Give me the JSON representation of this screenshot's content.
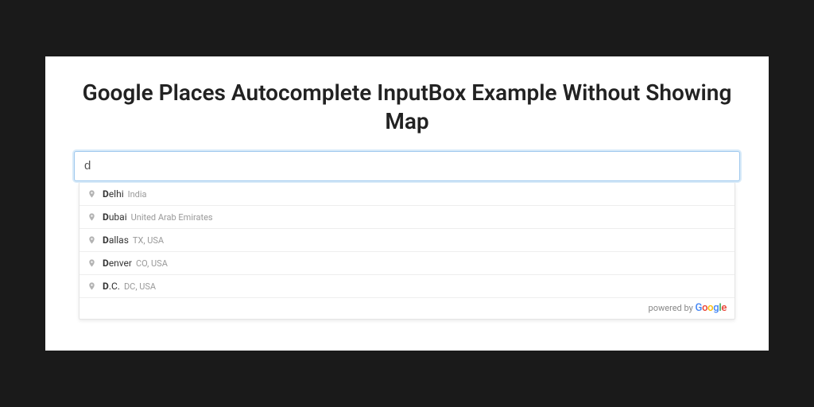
{
  "title": "Google Places Autocomplete InputBox Example Without Showing Map",
  "search": {
    "value": "d"
  },
  "suggestions": [
    {
      "match": "D",
      "rest": "elhi",
      "secondary": "India"
    },
    {
      "match": "D",
      "rest": "ubai",
      "secondary": "United Arab Emirates"
    },
    {
      "match": "D",
      "rest": "allas",
      "secondary": "TX, USA"
    },
    {
      "match": "D",
      "rest": "enver",
      "secondary": "CO, USA"
    },
    {
      "match": "D",
      "rest": ".C.",
      "secondary": "DC, USA"
    }
  ],
  "attribution": {
    "prefix": "powered by ",
    "logo": "Google"
  }
}
